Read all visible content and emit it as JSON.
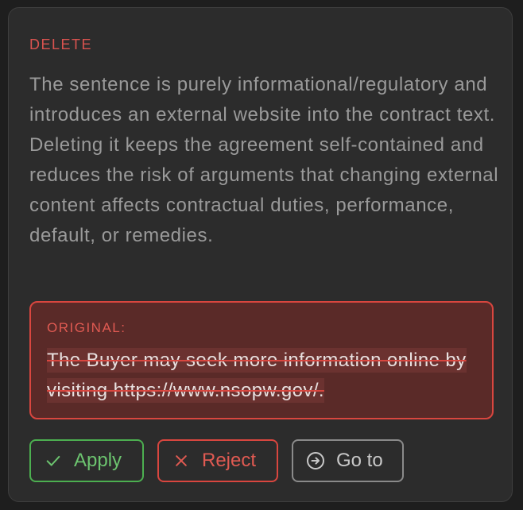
{
  "suggestion": {
    "action_label": "DELETE",
    "description": "The sentence is purely informational/regulatory and introduces an external website into the contract text. Deleting it keeps the agreement self-contained and reduces the risk of arguments that changing external content affects contractual duties, performance, default, or remedies.",
    "original_label": "ORIGINAL:",
    "original_text": "The Buyer may seek more information online by visiting https://www.nsopw.gov/."
  },
  "actions": {
    "apply_label": "Apply",
    "apply_icon": "check-icon",
    "reject_label": "Reject",
    "reject_icon": "close-icon",
    "goto_label": "Go to",
    "goto_icon": "arrow-circle-right-icon"
  },
  "colors": {
    "accent_delete": "#d9534f",
    "apply": "#4caf50",
    "reject": "#d9463f",
    "neutral": "#8a8a8a"
  }
}
